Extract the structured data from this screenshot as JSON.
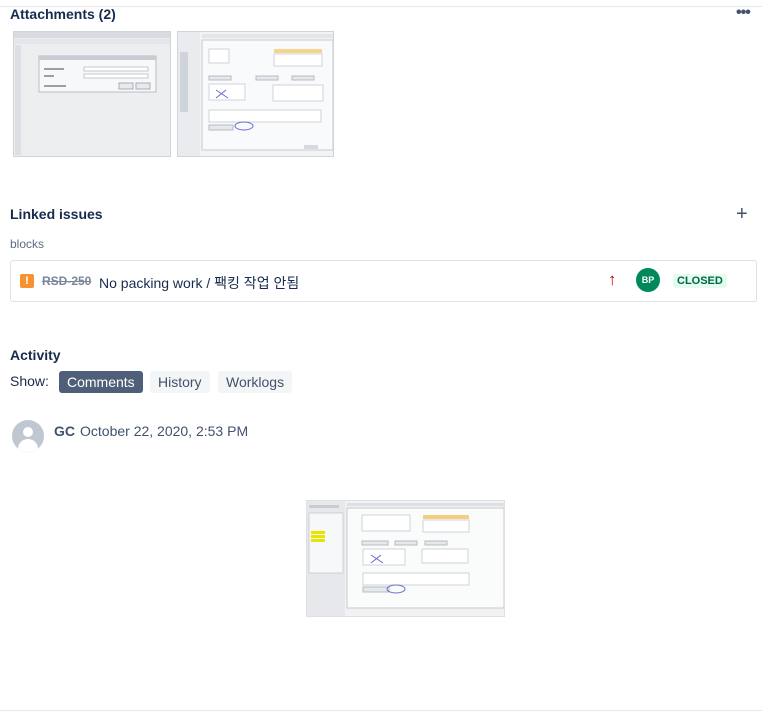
{
  "attachments": {
    "title": "Attachments (2)",
    "more_icon": "more-horizontal-icon",
    "items": [
      {
        "kind": "screenshot-thumbnail"
      },
      {
        "kind": "screenshot-thumbnail"
      }
    ]
  },
  "linked_issues": {
    "title": "Linked issues",
    "add_icon": "plus-icon",
    "relation": "blocks",
    "items": [
      {
        "type_icon": "bug-icon",
        "type_glyph": "!",
        "key": "RSD-250",
        "summary": "No packing work / 팩킹 작업 안됨",
        "priority_icon": "arrow-up-icon",
        "assignee_initials": "BP",
        "status": "CLOSED"
      }
    ]
  },
  "activity": {
    "title": "Activity",
    "show_label": "Show:",
    "tabs": [
      {
        "label": "Comments",
        "active": true
      },
      {
        "label": "History",
        "active": false
      },
      {
        "label": "Worklogs",
        "active": false
      }
    ],
    "comments": [
      {
        "author": "GC",
        "date": "October 22, 2020, 2:53 PM",
        "attachment": "embedded-screenshot"
      }
    ]
  },
  "colors": {
    "status_green": "#006644",
    "priority_red": "#cc0000",
    "active_tab": "#505f79"
  }
}
